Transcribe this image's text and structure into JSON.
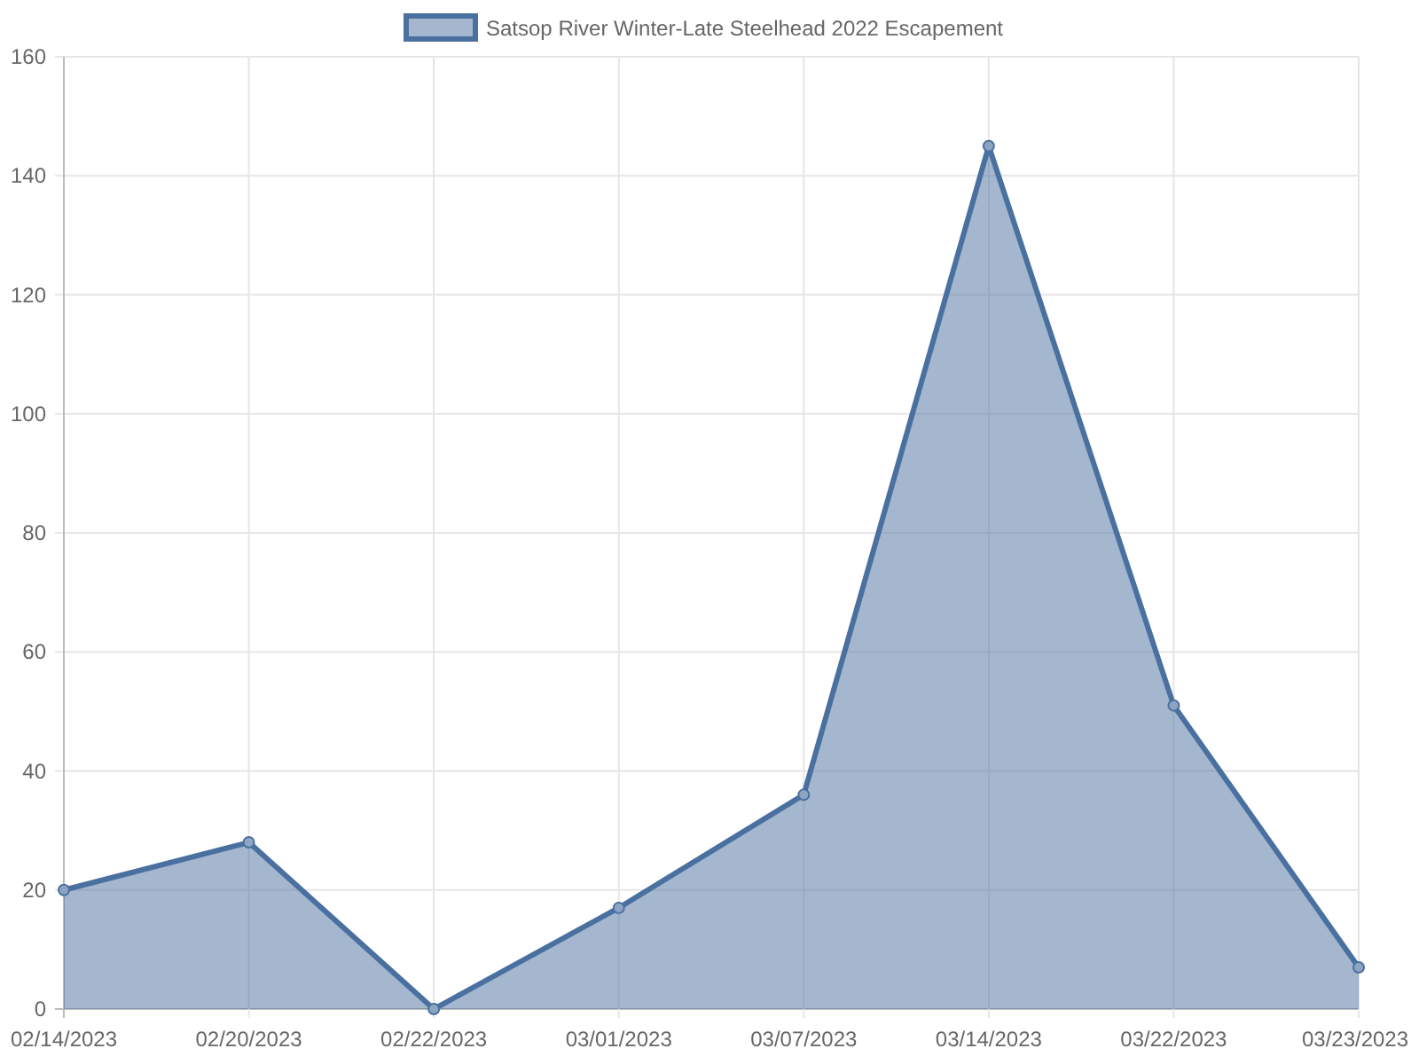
{
  "chart": {
    "chart_data": {
      "type": "area",
      "categories": [
        "02/14/2023",
        "02/20/2023",
        "02/22/2023",
        "03/01/2023",
        "03/07/2023",
        "03/14/2023",
        "03/22/2023",
        "03/23/2023"
      ],
      "series": [
        {
          "name": "Satsop River Winter-Late Steelhead 2022 Escapement",
          "color": "#4a70a0",
          "values": [
            20,
            28,
            0,
            17,
            36,
            145,
            51,
            7
          ]
        }
      ],
      "grid": true,
      "ylim": [
        0,
        160
      ],
      "yticks": [
        0,
        20,
        40,
        60,
        80,
        100,
        120,
        140,
        160
      ]
    }
  }
}
